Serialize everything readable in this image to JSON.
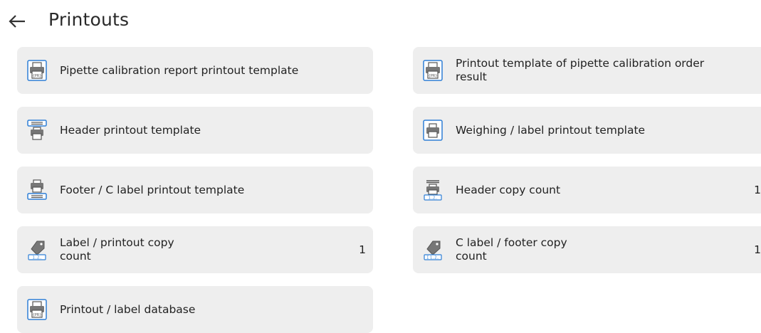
{
  "header": {
    "back_icon": "arrow-left-icon",
    "title": "Printouts"
  },
  "tiles": [
    {
      "label": "Pipette calibration report printout template",
      "icon": "printer-document-icon"
    },
    {
      "label": "Printout template of pipette calibration order result",
      "icon": "printer-document-icon"
    },
    {
      "label": "Header printout template",
      "icon": "printer-header-icon"
    },
    {
      "label": "Weighing / label printout template",
      "icon": "printer-framed-icon"
    },
    {
      "label": "Footer / C label printout template",
      "icon": "printer-footer-icon"
    },
    {
      "label": "Header copy count",
      "value": "1",
      "icon": "header-copy-count-icon"
    },
    {
      "label": "Label / printout copy count",
      "value": "1",
      "icon": "label-tag-count-icon"
    },
    {
      "label": "C label / footer copy count",
      "value": "1",
      "icon": "footer-tag-count-icon"
    },
    {
      "label": "Printout / label database",
      "icon": "printer-document-icon"
    }
  ],
  "colors": {
    "tile_bg": "#eeeeee",
    "icon_blue": "#2f7fd6",
    "icon_gray": "#555555"
  }
}
